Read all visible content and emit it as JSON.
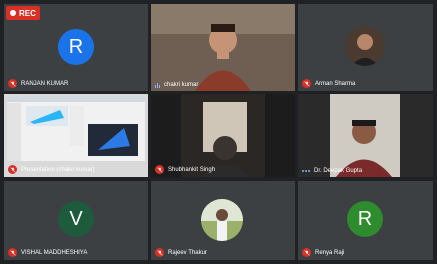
{
  "rec": {
    "label": "REC"
  },
  "tiles": [
    {
      "name": "RANJAN KUMAR",
      "initial": "R",
      "avatar_color": "#1a73e8",
      "mic": "muted"
    },
    {
      "name": "chakri kumar",
      "mic": "speaking"
    },
    {
      "name": "Arman Sharma",
      "mic": "muted"
    },
    {
      "name": "Presentation (chakri kumar)",
      "mic": "muted"
    },
    {
      "name": "Shubhankit Singh",
      "mic": "muted"
    },
    {
      "name": "Dr. Deepak Gupta",
      "mic": "active"
    },
    {
      "name": "VISHAL MADDHESHIYA",
      "initial": "V",
      "avatar_color": "#1e5a3c",
      "mic": "muted"
    },
    {
      "name": "Rajeev Thakur",
      "mic": "muted"
    },
    {
      "name": "Renya Raji",
      "initial": "R",
      "avatar_color": "#2e8b2e",
      "mic": "muted"
    }
  ],
  "colors": {
    "background": "#202124",
    "tile": "#3c4043",
    "muted_mic": "#d93025",
    "accent": "#8ab4f8"
  }
}
